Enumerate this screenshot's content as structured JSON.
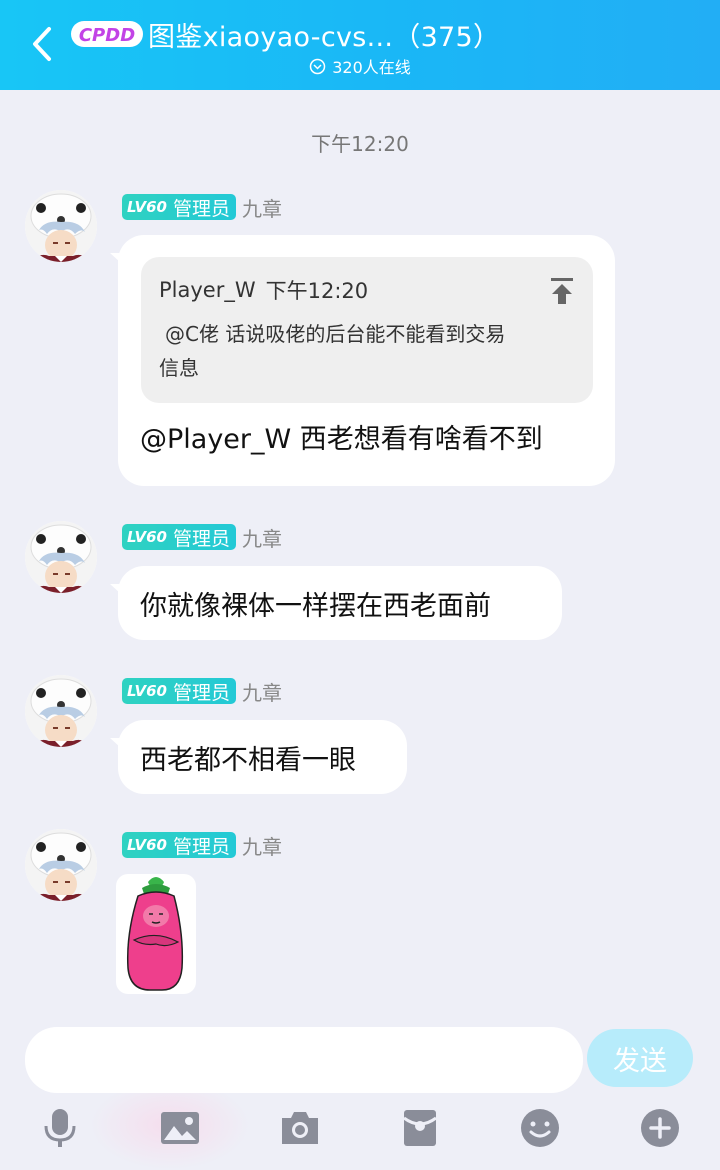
{
  "header": {
    "logo_text": "CPDD",
    "title": "图鉴xiaoyao-cvs...（375）",
    "online": "320人在线"
  },
  "time_divider": "下午12:20",
  "messages": [
    {
      "level": "LV60",
      "role": "管理员",
      "sender": "九章",
      "quote": {
        "author": "Player_W",
        "time": "下午12:20",
        "text_line1": "@C佬 话说吸佬的后台能不能看到交易",
        "text_line2": "信息"
      },
      "text": "@Player_W 西老想看有啥看不到"
    },
    {
      "level": "LV60",
      "role": "管理员",
      "sender": "九章",
      "text": "你就像裸体一样摆在西老面前"
    },
    {
      "level": "LV60",
      "role": "管理员",
      "sender": "九章",
      "text": "西老都不相看一眼"
    },
    {
      "level": "LV60",
      "role": "管理员",
      "sender": "九章",
      "sticker": "pink-radish-sticker"
    }
  ],
  "input": {
    "value": "",
    "send_label": "发送"
  },
  "toolbar": [
    "microphone-icon",
    "image-icon",
    "camera-icon",
    "red-packet-icon",
    "emoji-icon",
    "plus-icon"
  ],
  "colors": {
    "header_start": "#18c6f6",
    "header_end": "#22aef5",
    "badge": "#2fd2c1",
    "send_button": "#b7ecfb",
    "background": "#eeeff7",
    "toolbar_icon": "#8a8d99"
  }
}
